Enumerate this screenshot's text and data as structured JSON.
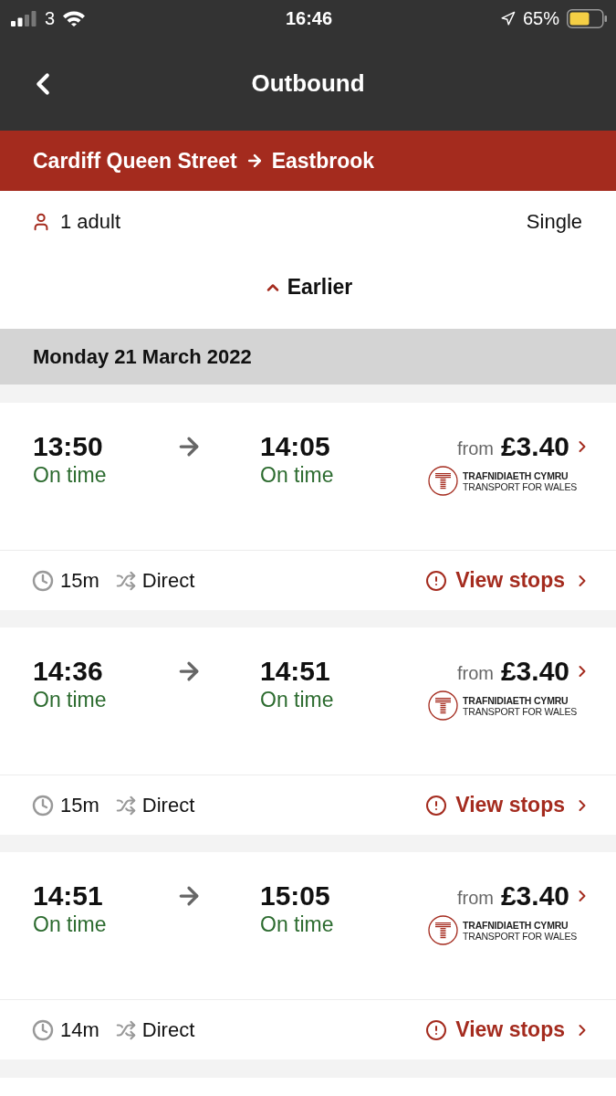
{
  "status_bar": {
    "carrier": "3",
    "time": "16:46",
    "battery_percent": "65%"
  },
  "header": {
    "title": "Outbound"
  },
  "route": {
    "origin": "Cardiff Queen Street",
    "destination": "Eastbrook"
  },
  "trip": {
    "passengers": "1 adult",
    "ticket": "Single"
  },
  "earlier_button": {
    "label": "Earlier"
  },
  "date_heading": "Monday 21 March 2022",
  "journeys": [
    {
      "departure": {
        "time": "13:50",
        "status": "On time"
      },
      "arrival": {
        "time": "14:05",
        "status": "On time"
      },
      "price_prefix": "from",
      "price": "£3.40",
      "operator": {
        "welsh": "TRAFNIDIAETH CYMRU",
        "english": "TRANSPORT FOR WALES"
      },
      "duration": "15m",
      "changes": "Direct",
      "stops_link": "View stops"
    },
    {
      "departure": {
        "time": "14:36",
        "status": "On time"
      },
      "arrival": {
        "time": "14:51",
        "status": "On time"
      },
      "price_prefix": "from",
      "price": "£3.40",
      "operator": {
        "welsh": "TRAFNIDIAETH CYMRU",
        "english": "TRANSPORT FOR WALES"
      },
      "duration": "15m",
      "changes": "Direct",
      "stops_link": "View stops"
    },
    {
      "departure": {
        "time": "14:51",
        "status": "On time"
      },
      "arrival": {
        "time": "15:05",
        "status": "On time"
      },
      "price_prefix": "from",
      "price": "£3.40",
      "operator": {
        "welsh": "TRAFNIDIAETH CYMRU",
        "english": "TRANSPORT FOR WALES"
      },
      "duration": "14m",
      "changes": "Direct",
      "stops_link": "View stops"
    }
  ]
}
